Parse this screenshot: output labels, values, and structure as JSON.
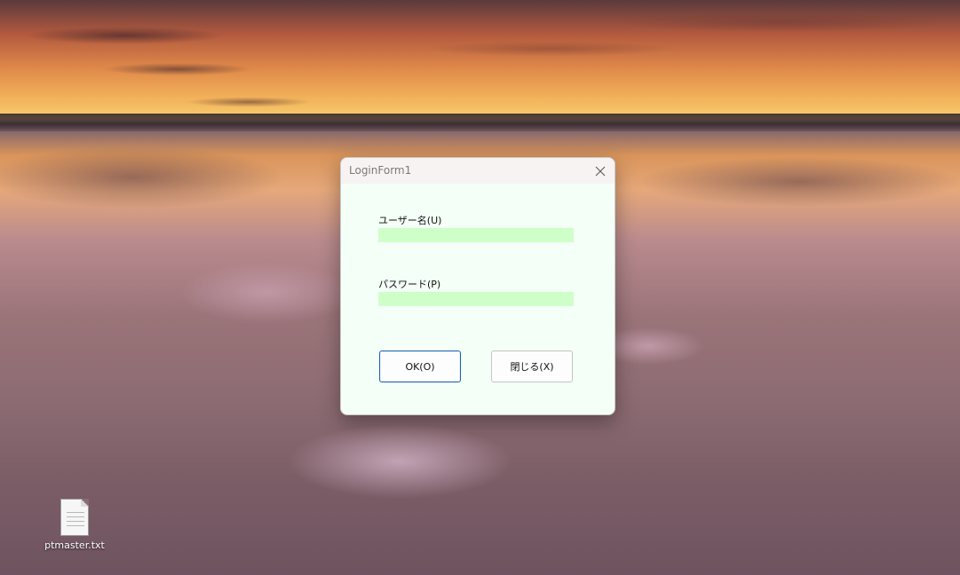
{
  "desktop": {
    "icons": [
      {
        "label": "ptmaster.txt",
        "icon": "text-file-icon"
      }
    ]
  },
  "dialog": {
    "title": "LoginForm1",
    "close_icon": "close-icon",
    "username": {
      "label": "ユーザー名(U)",
      "value": ""
    },
    "password": {
      "label": "パスワード(P)",
      "value": ""
    },
    "ok_label": "OK(O)",
    "close_label": "閉じる(X)"
  },
  "colors": {
    "dialog_background": "#f4fff8",
    "input_background": "#cfffc9",
    "primary_button_border": "#1c64b0"
  }
}
